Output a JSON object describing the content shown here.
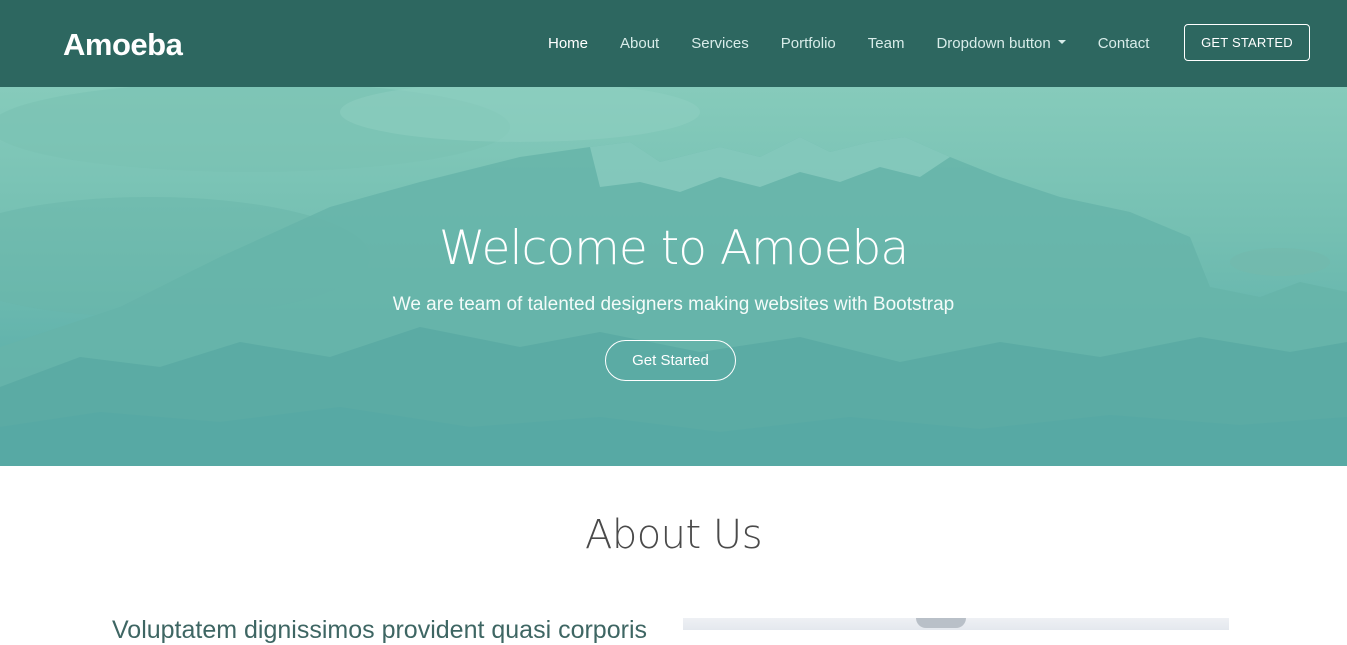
{
  "brand": "Amoeba",
  "nav": {
    "links": [
      {
        "label": "Home",
        "active": true
      },
      {
        "label": "About"
      },
      {
        "label": "Services"
      },
      {
        "label": "Portfolio"
      },
      {
        "label": "Team"
      },
      {
        "label": "Dropdown button",
        "dropdown": true
      },
      {
        "label": "Contact"
      }
    ],
    "cta": "GET STARTED"
  },
  "hero": {
    "title": "Welcome to Amoeba",
    "subtitle": "We are team of talented designers making websites with Bootstrap",
    "button": "Get Started"
  },
  "about": {
    "title": "About Us",
    "lead": "Voluptatem dignissimos provident quasi corporis"
  },
  "colors": {
    "navbar": "#2d6760",
    "hero_overlay": "#5cafaa",
    "accent": "#ffffff"
  },
  "icons": {
    "dropdown": "caret-down-icon"
  }
}
